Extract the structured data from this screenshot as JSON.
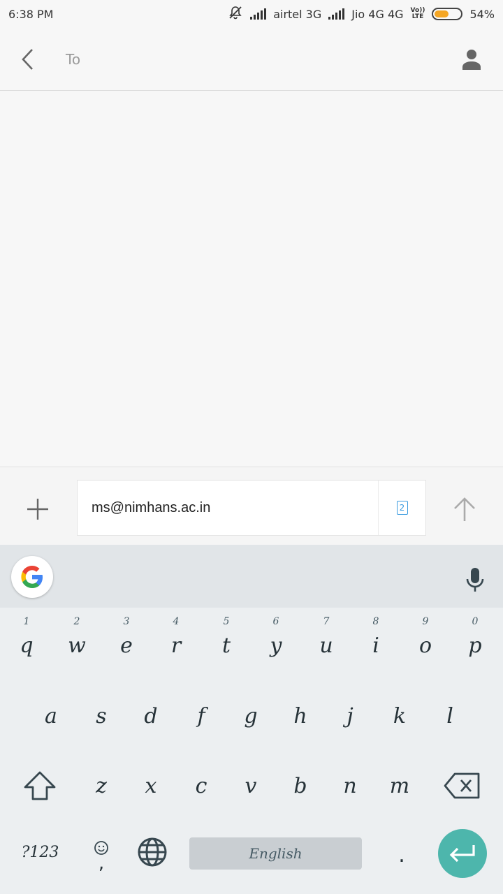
{
  "status_bar": {
    "time": "6:38 PM",
    "carrier1": "airtel 3G",
    "carrier2": "Jio 4G 4G",
    "volte_top": "Vo))",
    "volte_bottom": "LTE",
    "battery_percent": "54%",
    "battery_level": 0.54,
    "battery_color": "#f5a623"
  },
  "header": {
    "to_label": "To"
  },
  "compose": {
    "message_text": "ms@nimhans.ac.in",
    "sim_number": "2"
  },
  "keyboard": {
    "row1": [
      {
        "hint": "1",
        "key": "q"
      },
      {
        "hint": "2",
        "key": "w"
      },
      {
        "hint": "3",
        "key": "e"
      },
      {
        "hint": "4",
        "key": "r"
      },
      {
        "hint": "5",
        "key": "t"
      },
      {
        "hint": "6",
        "key": "y"
      },
      {
        "hint": "7",
        "key": "u"
      },
      {
        "hint": "8",
        "key": "i"
      },
      {
        "hint": "9",
        "key": "o"
      },
      {
        "hint": "0",
        "key": "p"
      }
    ],
    "row2": [
      "a",
      "s",
      "d",
      "f",
      "g",
      "h",
      "j",
      "k",
      "l"
    ],
    "row3": [
      "z",
      "x",
      "c",
      "v",
      "b",
      "n",
      "m"
    ],
    "symbols_label": "?123",
    "emoji_comma": ",",
    "space_label": "English",
    "period_label": ".",
    "enter_color": "#4db6ac"
  }
}
